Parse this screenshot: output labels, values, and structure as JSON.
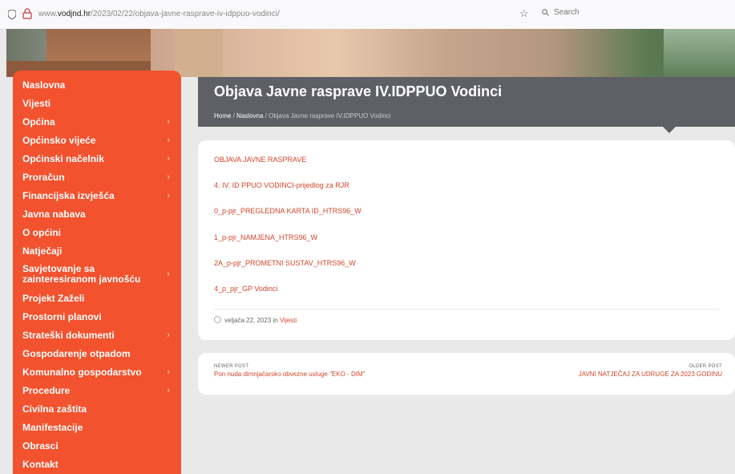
{
  "browser": {
    "url_prefix": "www.",
    "url_domain": "vodjnd.hr",
    "url_path": "/2023/02/22/objava-javne-rasprave-iv-idppuo-vodinci/",
    "search_placeholder": "Search"
  },
  "sidebar": {
    "items": [
      {
        "label": "Naslovna",
        "has_submenu": false
      },
      {
        "label": "Vijesti",
        "has_submenu": false
      },
      {
        "label": "Općina",
        "has_submenu": true
      },
      {
        "label": "Općinsko vijeće",
        "has_submenu": true
      },
      {
        "label": "Općinski načelnik",
        "has_submenu": true
      },
      {
        "label": "Proračun",
        "has_submenu": true
      },
      {
        "label": "Financijska izvješća",
        "has_submenu": true
      },
      {
        "label": "Javna nabava",
        "has_submenu": false
      },
      {
        "label": "O općini",
        "has_submenu": false
      },
      {
        "label": "Natječaji",
        "has_submenu": false
      },
      {
        "label": "Savjetovanje sa zainteresiranom javnošću",
        "has_submenu": true
      },
      {
        "label": "Projekt Zaželi",
        "has_submenu": false
      },
      {
        "label": "Prostorni planovi",
        "has_submenu": false
      },
      {
        "label": "Strateški dokumenti",
        "has_submenu": true
      },
      {
        "label": "Gospodarenje otpadom",
        "has_submenu": false
      },
      {
        "label": "Komunalno gospodarstvo",
        "has_submenu": true
      },
      {
        "label": "Procedure",
        "has_submenu": true
      },
      {
        "label": "Civilna zaštita",
        "has_submenu": false
      },
      {
        "label": "Manifestacije",
        "has_submenu": false
      },
      {
        "label": "Obrasci",
        "has_submenu": false
      },
      {
        "label": "Kontakt",
        "has_submenu": false
      }
    ],
    "chevron": "›"
  },
  "page": {
    "title": "Objava Javne rasprave IV.IDPPUO Vodinci",
    "breadcrumb_home": "Home",
    "breadcrumb_sep": "/",
    "breadcrumb_section": "Naslovna",
    "breadcrumb_current": "Objava Javne rasprave IV.IDPPUO Vodinci"
  },
  "documents": [
    "OBJAVA JAVNE RASPRAVE",
    "4. IV. ID PPUO VODINCI-prijedlog za RJR",
    "0_p-pjr_PREGLEDNA KARTA ID_HTRS96_W",
    "1_p-pjr_NAMJENA_HTRS96_W",
    "2A_p-pjr_PROMETNI SUSTAV_HTRS96_W",
    "4_p_pjr_GP Vodinci"
  ],
  "meta": {
    "date": "veljača 22, 2023",
    "in_word": "in",
    "category": "Vijesti"
  },
  "postnav": {
    "newer_label": "NEWER POST",
    "newer_title": "Pon nuda dimnjačarsko obvezne usluge \"EKO - DIM\"",
    "older_label": "OLDER POST",
    "older_title": "JAVNI NATJEČAJ ZA UDRUGE ZA 2023 GODINU"
  },
  "colors": {
    "accent": "#f2522e",
    "link": "#d2452b",
    "title_band": "#5e6066"
  }
}
